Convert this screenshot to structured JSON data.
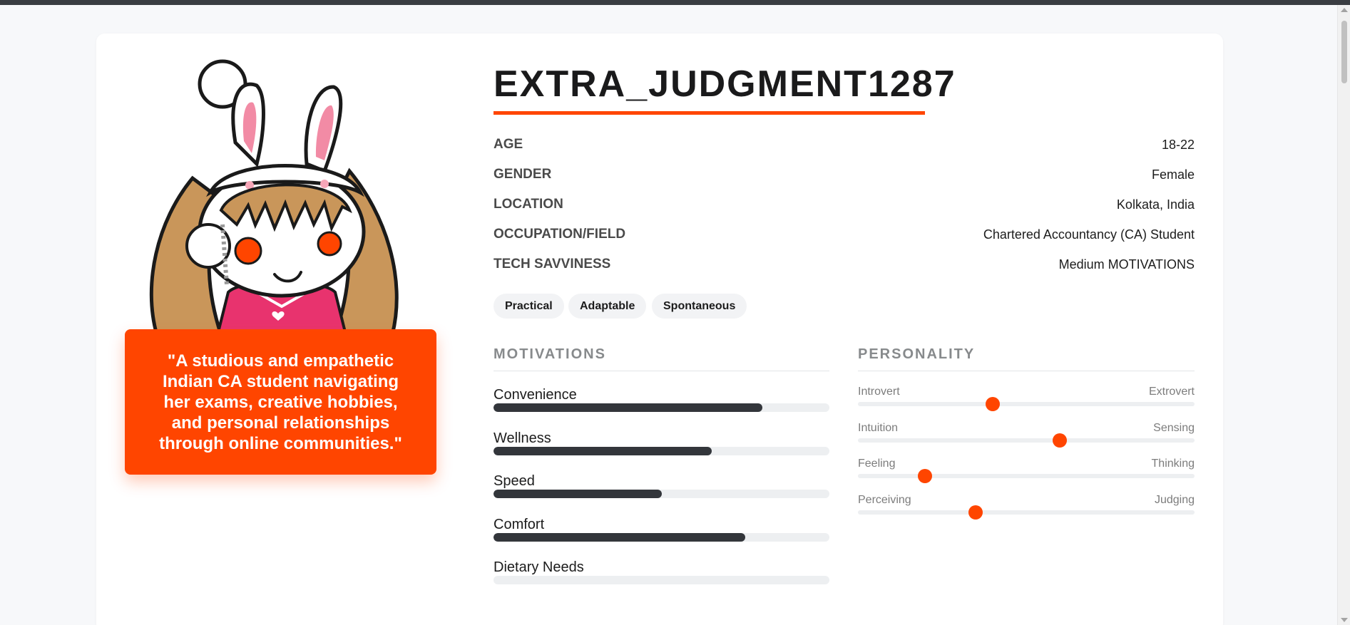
{
  "colors": {
    "accent": "#ff4500",
    "bar_fill": "#33363b",
    "track": "#edeff1"
  },
  "persona": {
    "name": "EXTRA_JUDGMENT1287",
    "avatar_icon": "snoo-bunny-avatar",
    "quote": "\"A studious and empathetic Indian CA student navigating her exams, creative hobbies, and personal relationships through online communities.\""
  },
  "info": [
    {
      "label": "AGE",
      "value": "18-22"
    },
    {
      "label": "GENDER",
      "value": "Female"
    },
    {
      "label": "LOCATION",
      "value": "Kolkata, India"
    },
    {
      "label": "OCCUPATION/FIELD",
      "value": "Chartered Accountancy (CA) Student"
    },
    {
      "label": "TECH SAVVINESS",
      "value": "Medium MOTIVATIONS"
    }
  ],
  "tags": [
    "Practical",
    "Adaptable",
    "Spontaneous"
  ],
  "motivations": {
    "title": "MOTIVATIONS",
    "items": [
      {
        "label": "Convenience",
        "level": 0.8
      },
      {
        "label": "Wellness",
        "level": 0.65
      },
      {
        "label": "Speed",
        "level": 0.5
      },
      {
        "label": "Comfort",
        "level": 0.75
      },
      {
        "label": "Dietary Needs",
        "level": 0.0
      }
    ]
  },
  "personality": {
    "title": "PERSONALITY",
    "traits": [
      {
        "left": "Introvert",
        "right": "Extrovert",
        "position": 0.4
      },
      {
        "left": "Intuition",
        "right": "Sensing",
        "position": 0.6
      },
      {
        "left": "Feeling",
        "right": "Thinking",
        "position": 0.2
      },
      {
        "left": "Perceiving",
        "right": "Judging",
        "position": 0.35
      }
    ]
  }
}
